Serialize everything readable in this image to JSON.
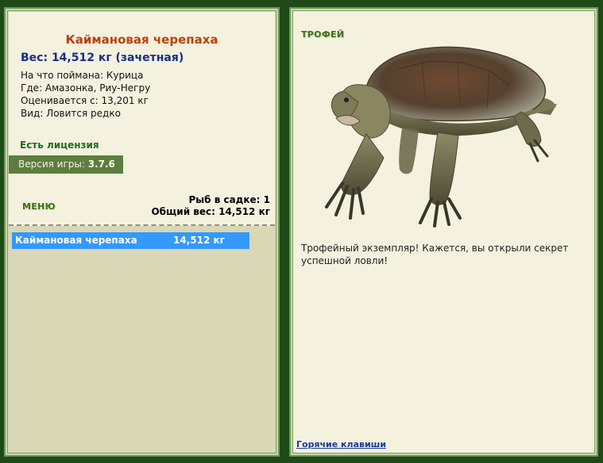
{
  "fish": {
    "name": "Каймановая черепаха",
    "weight_line": "Вес: 14,512 кг (зачетная)",
    "bait": "На что поймана: Курица",
    "location": "Где: Амазонка, Риу-Негру",
    "value": "Оценивается с: 13,201 кг",
    "rarity": "Вид: Ловится редко"
  },
  "license_label": "Есть лицензия",
  "version": {
    "label": "Версия игры:",
    "value": "3.7.6"
  },
  "menu_label": "МЕНЮ",
  "keepnet": {
    "count_line": "Рыб в садке: 1",
    "total_line": "Общий вес: 14,512 кг"
  },
  "catch_list": [
    {
      "name": "Каймановая черепаха",
      "weight": "14,512 кг"
    }
  ],
  "trophy": {
    "heading": "ТРОФЕЙ",
    "text": "Трофейный экземпляр! Кажется, вы открыли секрет успешной ловли!"
  },
  "hotkeys_label": "Горячие клавиши",
  "colors": {
    "frame": "#1f4a17",
    "fish_name": "#b8420e",
    "weight": "#152f86",
    "license": "#1d6d1d",
    "selection": "#3399ff"
  }
}
